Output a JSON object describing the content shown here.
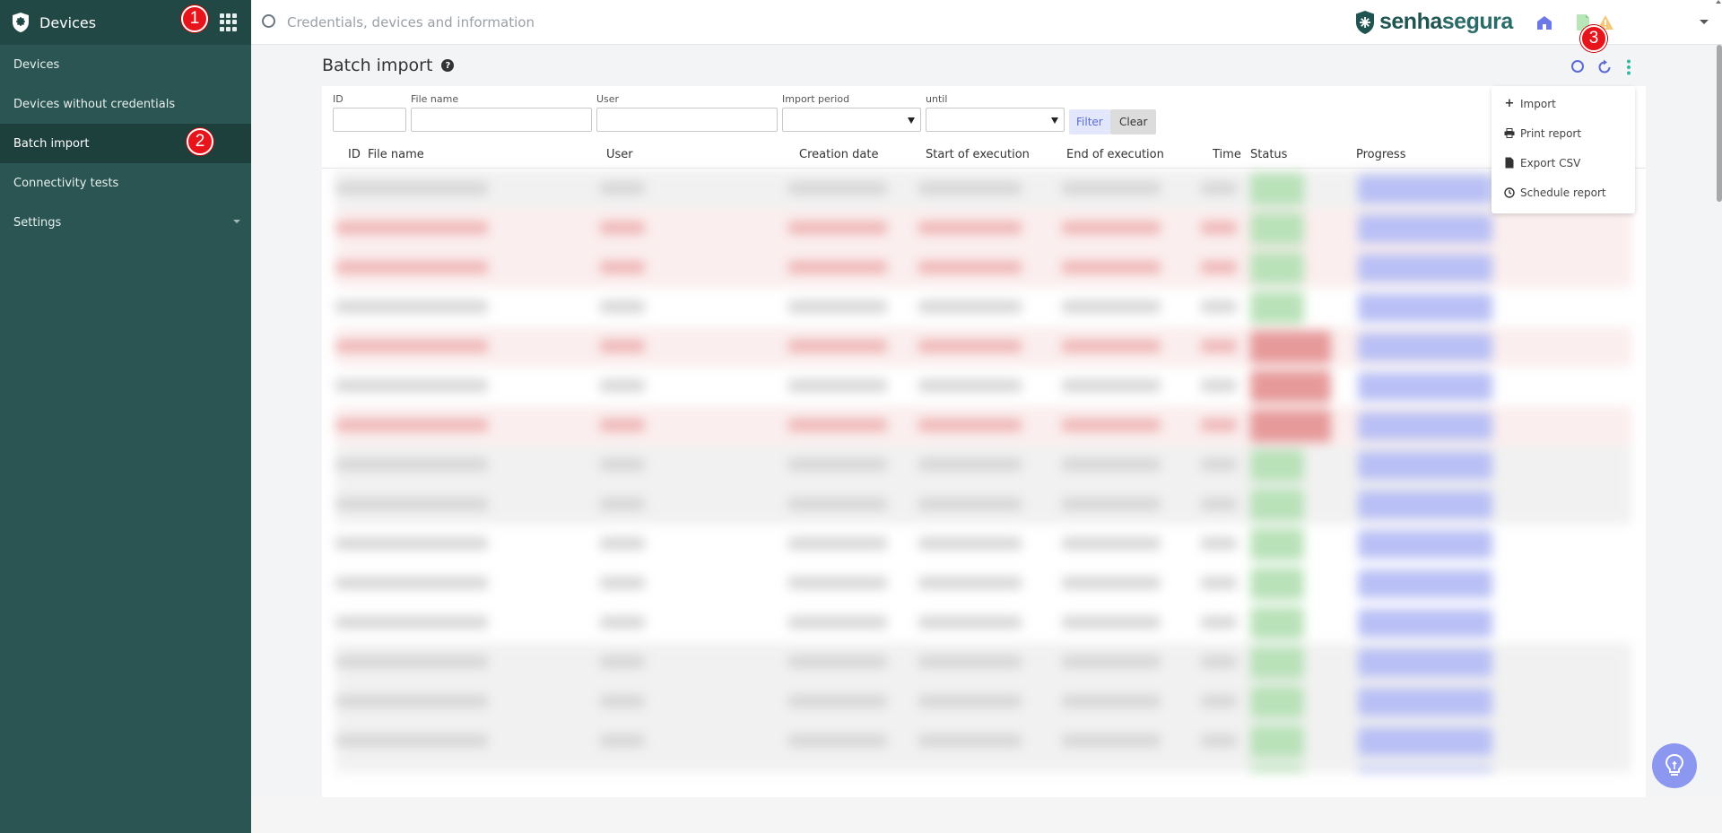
{
  "sidebar": {
    "title": "Devices",
    "items": [
      {
        "label": "Devices"
      },
      {
        "label": "Devices without credentials"
      },
      {
        "label": "Batch import"
      },
      {
        "label": "Connectivity tests"
      },
      {
        "label": "Settings"
      }
    ]
  },
  "topbar": {
    "search_placeholder": "Credentials, devices and information",
    "brand_part1": "senha",
    "brand_part2": "segura"
  },
  "badges": {
    "one": "1",
    "two": "2",
    "three": "3"
  },
  "page": {
    "title": "Batch import"
  },
  "filters": {
    "id_label": "ID",
    "file_name_label": "File name",
    "user_label": "User",
    "import_period_label": "Import period",
    "until_label": "until",
    "filter_button": "Filter",
    "clear_button": "Clear"
  },
  "table": {
    "columns": [
      "ID",
      "File name",
      "User",
      "Creation date",
      "Start of execution",
      "End of execution",
      "Time",
      "Status",
      "Progress"
    ]
  },
  "menu": {
    "items": [
      {
        "label": "Import",
        "icon": "plus-icon"
      },
      {
        "label": "Print report",
        "icon": "printer-icon"
      },
      {
        "label": "Export CSV",
        "icon": "file-icon"
      },
      {
        "label": "Schedule report",
        "icon": "clock-icon"
      }
    ]
  },
  "colors": {
    "sidebar_bg": "#2a5552",
    "sidebar_header": "#224845",
    "brand": "#1f5451",
    "accent": "#5a6bd8",
    "badge": "#e8141c"
  }
}
